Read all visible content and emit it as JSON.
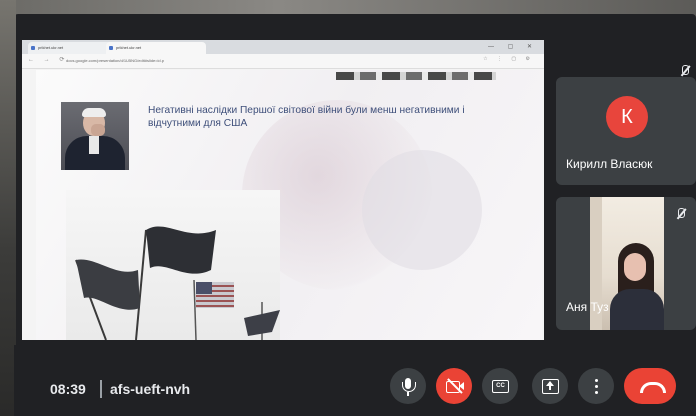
{
  "browser": {
    "tabs": [
      {
        "label": "prikhet.ukr.net"
      },
      {
        "label": "prikhet.ukr.net"
      }
    ],
    "window_controls": "— ▢ ✕",
    "url": "docs.google.com/presentation/d/1U5NG/edit#slide=id.p",
    "nav_glyphs": "← → ⟳",
    "toolbar_glyphs": "☆ ⋮ ▢ ⚙"
  },
  "slide": {
    "text": "Негативні наслідки Першої світової війни були менш негативними і відчутними для США"
  },
  "participants": [
    {
      "initial": "К",
      "name": "Кирилл Власюк",
      "avatar_color": "#e8453c",
      "muted": true
    },
    {
      "name": "Аня Туз",
      "muted": true
    }
  ],
  "meeting": {
    "time": "08:39",
    "code": "afs-ueft-nvh",
    "cc_label": "CC"
  },
  "colors": {
    "end_call": "#ea4335",
    "control_bg": "#3c4043",
    "slide_text": "#3e4f7a"
  }
}
